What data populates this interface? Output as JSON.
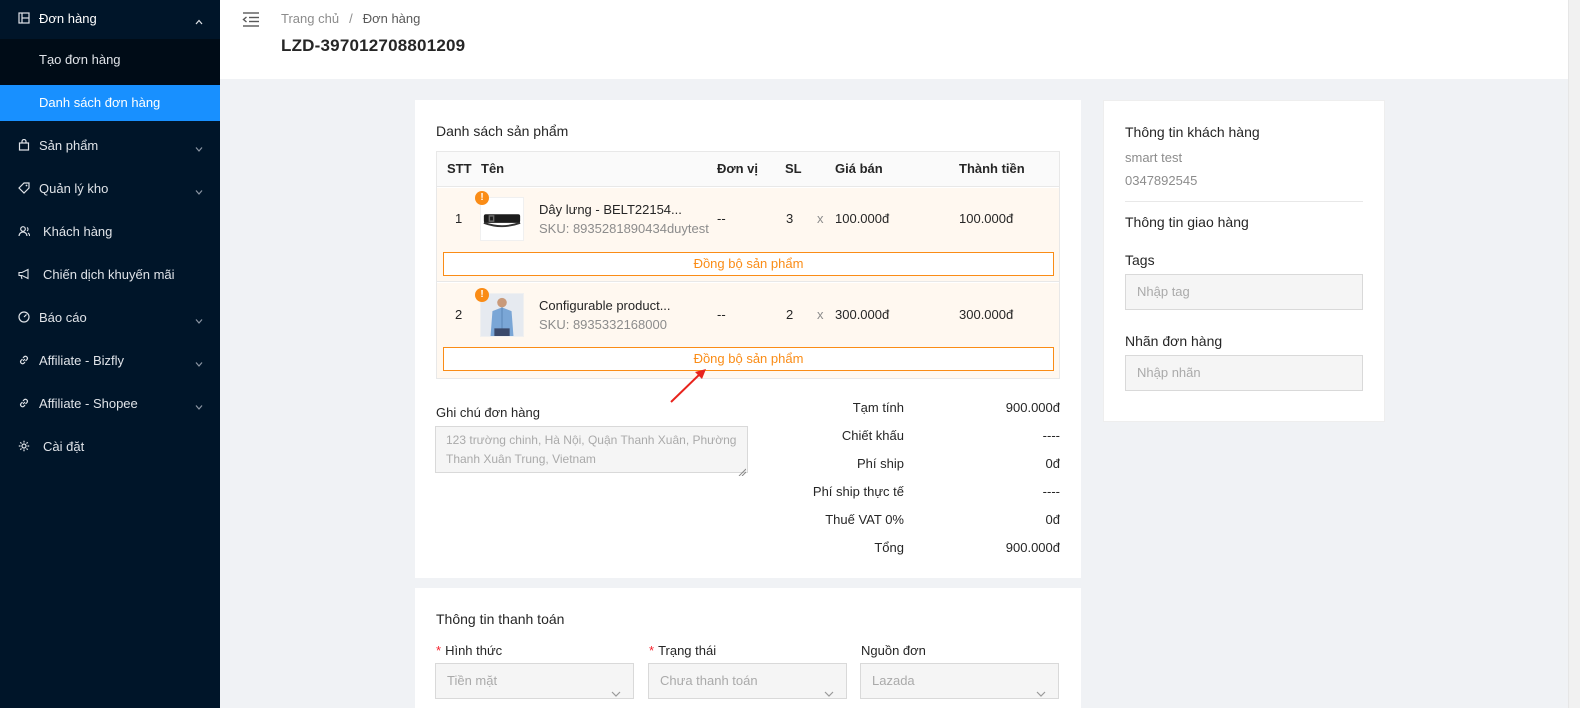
{
  "sidebar": {
    "orders": {
      "label": "Đơn hàng",
      "icon": "orders-icon"
    },
    "orders_sub": [
      {
        "label": "Tạo đơn hàng"
      },
      {
        "label": "Danh sách đơn hàng",
        "active": true
      }
    ],
    "items": [
      {
        "label": "Sản phẩm",
        "icon": "bag-icon"
      },
      {
        "label": "Quản lý kho",
        "icon": "tag-icon"
      },
      {
        "label": "Khách hàng",
        "icon": "users-icon"
      },
      {
        "label": "Chiến dịch khuyến mãi",
        "icon": "megaphone-icon"
      },
      {
        "label": "Báo cáo",
        "icon": "dashboard-icon"
      },
      {
        "label": "Affiliate - Bizfly",
        "icon": "link-icon"
      },
      {
        "label": "Affiliate - Shopee",
        "icon": "link-icon"
      },
      {
        "label": "Cài đặt",
        "icon": "gear-icon"
      }
    ]
  },
  "header": {
    "breadcrumb": [
      "Trang chủ",
      "Đơn hàng"
    ],
    "breadcrumb_sep": "/",
    "title": "LZD-397012708801209"
  },
  "products": {
    "title": "Danh sách sản phẩm",
    "columns": [
      "STT",
      "Tên",
      "Đơn vị",
      "SL",
      "Giá bán",
      "Thành tiền"
    ],
    "rows": [
      {
        "stt": "1",
        "name": "Dây lưng - BELT22154...",
        "sku": "SKU: 8935281890434duytest",
        "unit": "--",
        "qty": "3",
        "x": "x",
        "price": "100.000đ",
        "total": "100.000đ",
        "warn": "!",
        "sync": "Đồng bộ sản phẩm"
      },
      {
        "stt": "2",
        "name": "Configurable product...",
        "sku": "SKU: 8935332168000",
        "unit": "--",
        "qty": "2",
        "x": "x",
        "price": "300.000đ",
        "total": "300.000đ",
        "warn": "!",
        "sync": "Đồng bộ sản phẩm"
      }
    ]
  },
  "note": {
    "label": "Ghi chú đơn hàng",
    "placeholder": "123 trường chinh, Hà Nội, Quận Thanh Xuân, Phường Thanh Xuân Trung, Vietnam"
  },
  "summary": [
    {
      "label": "Tạm tính",
      "value": "900.000đ"
    },
    {
      "label": "Chiết khấu",
      "value": "----"
    },
    {
      "label": "Phí ship",
      "value": "0đ"
    },
    {
      "label": "Phí ship thực tế",
      "value": "----"
    },
    {
      "label": "Thuế VAT 0%",
      "value": "0đ"
    },
    {
      "label": "Tổng",
      "value": "900.000đ"
    }
  ],
  "customer": {
    "title": "Thông tin khách hàng",
    "name": "smart test",
    "phone": "0347892545",
    "shipping_title": "Thông tin giao hàng",
    "tags_label": "Tags",
    "tags_placeholder": "Nhập tag",
    "label_label": "Nhãn đơn hàng",
    "label_placeholder": "Nhập nhãn"
  },
  "payment": {
    "title": "Thông tin thanh toán",
    "required_mark": "*",
    "method_label": "Hình thức",
    "method_value": "Tiền mặt",
    "status_label": "Trạng thái",
    "status_value": "Chưa thanh toán",
    "source_label": "Nguồn đơn",
    "source_value": "Lazada"
  },
  "colors": {
    "sidebar_bg": "#001529",
    "active": "#1890ff",
    "warning": "#fa8c16",
    "annotation_arrow": "#e8231c"
  }
}
